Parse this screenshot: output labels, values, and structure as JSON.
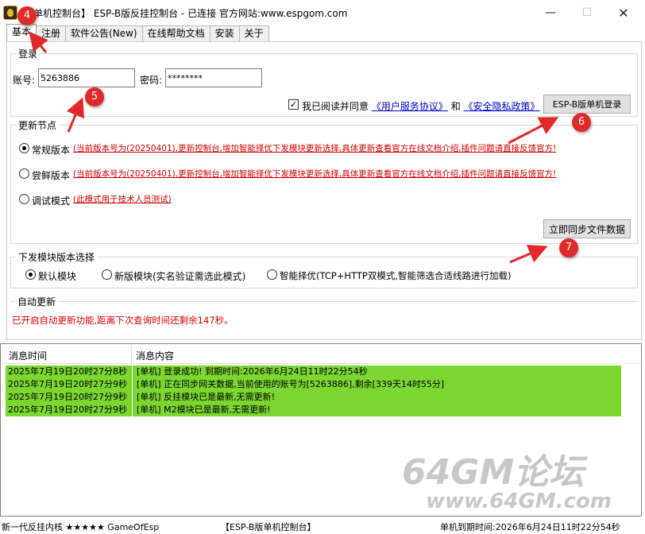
{
  "window": {
    "title": "【单机控制台】 ESP-B版反挂控制台 - 已连接  官方网站:www.espgom.com",
    "minimize_glyph": "—",
    "maximize_glyph": "☐",
    "close_glyph": "✕"
  },
  "tabs": [
    "基本",
    "注册",
    "软件公告(New)",
    "在线帮助文档",
    "安装",
    "关于"
  ],
  "login": {
    "group_title": "登录",
    "account_label": "账号:",
    "account_value": "5263886",
    "password_label": "密码:",
    "password_value": "********",
    "agree_text": "我已阅读并同意",
    "user_agreement": "《用户服务协议》",
    "and_text": "和",
    "privacy_policy": "《安全隐私政策》",
    "agree_checked": true,
    "login_button": "ESP-B版单机登录"
  },
  "update_node": {
    "group_title": "更新节点",
    "options": [
      {
        "label": "常规版本",
        "desc": "(当前版本号为(20250401),更新控制台,增加智能择优下发模块更新选择,具体更新查看官方在线文档介绍,插件问题请直接反馈官方!",
        "selected": true
      },
      {
        "label": "尝鲜版本",
        "desc": "(当前版本号为(20250401),更新控制台,增加智能择优下发模块更新选择,具体更新查看官方在线文档介绍,插件问题请直接反馈官方!",
        "selected": false
      },
      {
        "label": "调试模式",
        "desc": "(此模式用于技术人员测试)",
        "selected": false
      }
    ],
    "sync_button": "立即同步文件数据"
  },
  "module_version": {
    "group_title": "下发模块版本选择",
    "options": [
      {
        "label": "默认模块",
        "selected": true
      },
      {
        "label": "新版模块(实名验证需选此模式)",
        "selected": false
      },
      {
        "label": "智能择优(TCP+HTTP双模式,智能筛选合适线路进行加载)",
        "selected": false
      }
    ]
  },
  "auto_update": {
    "group_title": "自动更新",
    "status_text": "已开启自动更新功能,距离下次查询时间还剩余147秒。"
  },
  "log": {
    "col_time": "消息时间",
    "col_content": "消息内容",
    "rows": [
      {
        "time": "2025年7月19日20时27分8秒",
        "content": "[单机] 登录成功! 到期时间:2026年6月24日11时22分54秒"
      },
      {
        "time": "2025年7月19日20时27分9秒",
        "content": "[单机] 正在同步网关数据,当前使用的账号为[5263886],剩余[339天14时55分]"
      },
      {
        "time": "2025年7月19日20时27分9秒",
        "content": "[单机] 反挂模块已是最新,无需更新!"
      },
      {
        "time": "2025年7月19日20时27分9秒",
        "content": "[单机] M2模块已是最新,无需更新!"
      }
    ]
  },
  "status_bar": {
    "left": "新一代反挂内核 ★★★★★ GameOfEsp",
    "middle": "【ESP-B版单机控制台】",
    "right": "单机到期时间:2026年6月24日11时22分54秒"
  },
  "annotations": [
    "4",
    "5",
    "6",
    "7"
  ],
  "watermark": {
    "line1": "64GM论坛",
    "line2": "www.64GM.com"
  },
  "colors": {
    "log_row_bg": "#7bd630",
    "badge_red": "#e02a2a",
    "link_red": "#cc0000",
    "link_blue": "#0000cc"
  }
}
